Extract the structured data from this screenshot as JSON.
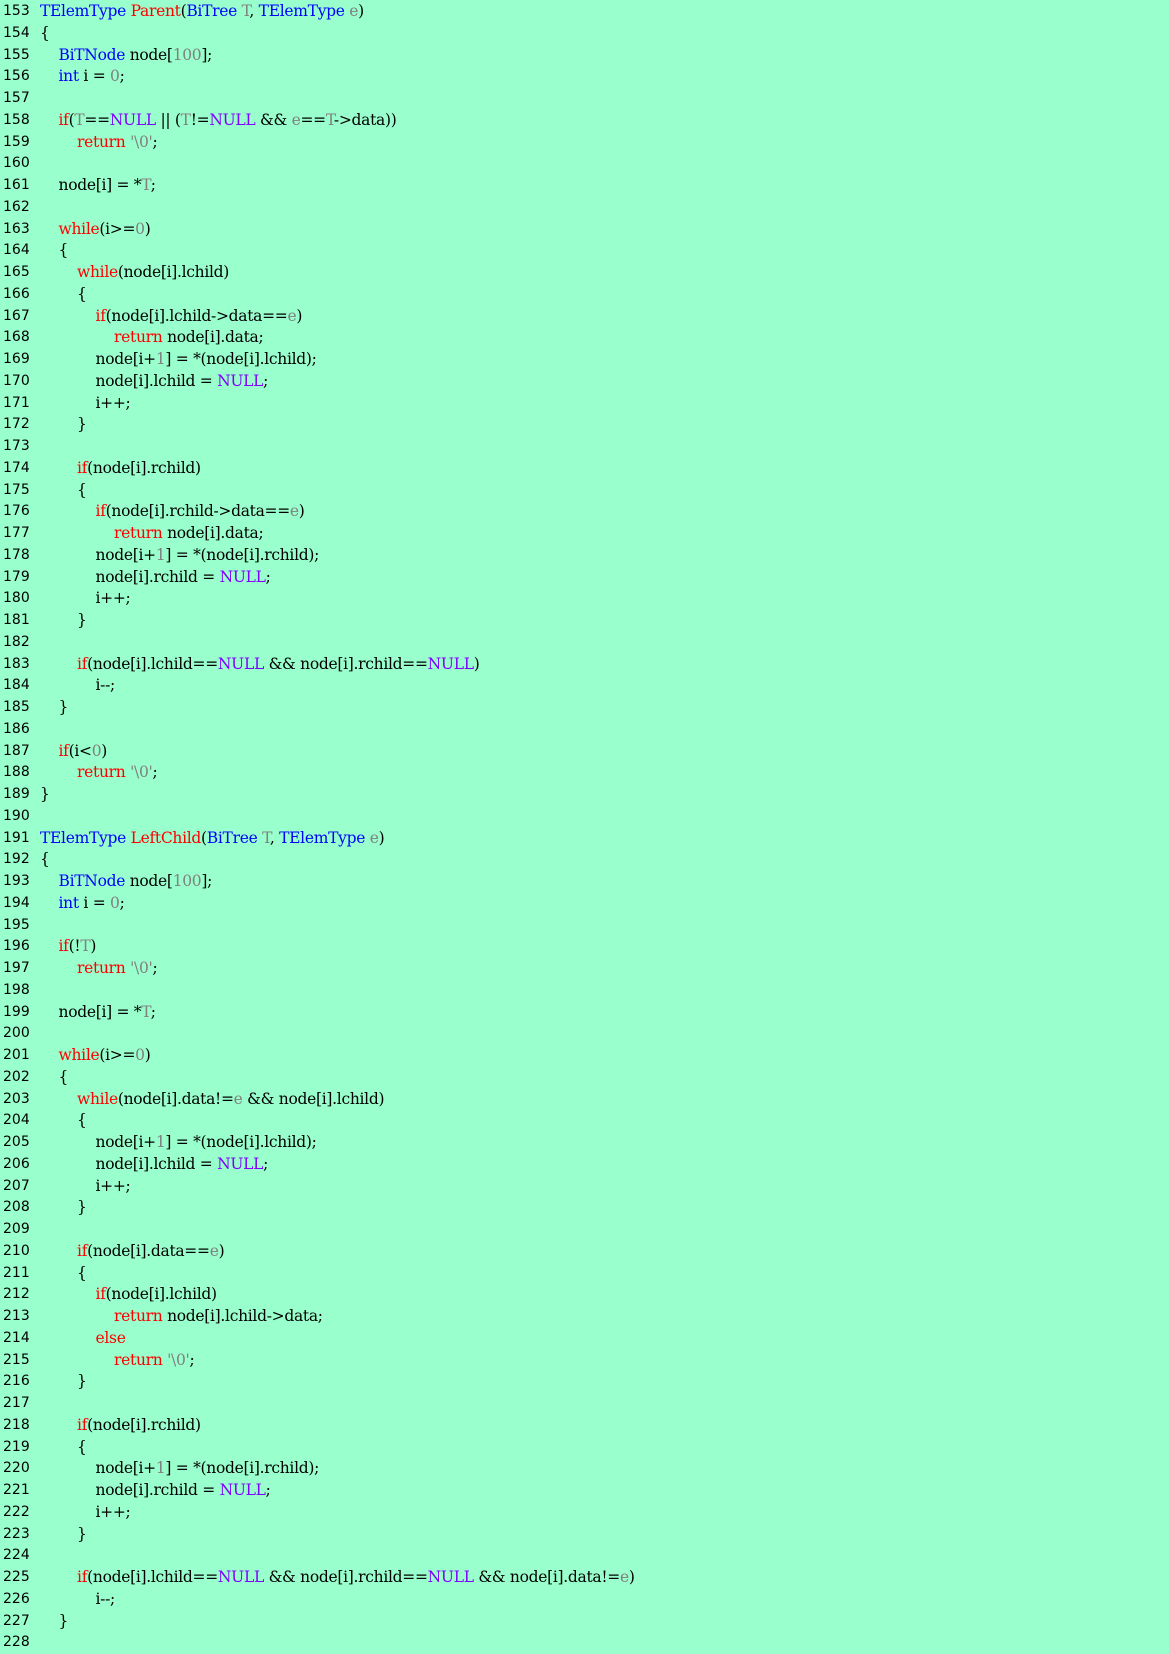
{
  "editor": {
    "background": "#99ffcc",
    "colors": {
      "type": "#0000ff",
      "keyword": "#ff0000",
      "number": "#808080",
      "param": "#808080",
      "string": "#808080",
      "constant": "#8000ff",
      "plain": "#000000"
    },
    "lines": [
      {
        "n": "153",
        "tokens": [
          [
            "type",
            "TElemType"
          ],
          [
            "plain",
            " "
          ],
          [
            "kw",
            "Parent"
          ],
          [
            "plain",
            "("
          ],
          [
            "type",
            "BiTree"
          ],
          [
            "plain",
            " "
          ],
          [
            "param",
            "T"
          ],
          [
            "plain",
            ", "
          ],
          [
            "type",
            "TElemType"
          ],
          [
            "plain",
            " "
          ],
          [
            "param",
            "e"
          ],
          [
            "plain",
            ")"
          ]
        ]
      },
      {
        "n": "154",
        "tokens": [
          [
            "plain",
            "{"
          ]
        ]
      },
      {
        "n": "155",
        "tokens": [
          [
            "plain",
            "    "
          ],
          [
            "type",
            "BiTNode"
          ],
          [
            "plain",
            " node["
          ],
          [
            "num",
            "100"
          ],
          [
            "plain",
            "];"
          ]
        ]
      },
      {
        "n": "156",
        "tokens": [
          [
            "plain",
            "    "
          ],
          [
            "type",
            "int"
          ],
          [
            "plain",
            " i = "
          ],
          [
            "num",
            "0"
          ],
          [
            "plain",
            ";"
          ]
        ]
      },
      {
        "n": "157",
        "tokens": []
      },
      {
        "n": "158",
        "tokens": [
          [
            "plain",
            "    "
          ],
          [
            "kw",
            "if"
          ],
          [
            "plain",
            "("
          ],
          [
            "param",
            "T"
          ],
          [
            "plain",
            "=="
          ],
          [
            "const",
            "NULL"
          ],
          [
            "plain",
            " || ("
          ],
          [
            "param",
            "T"
          ],
          [
            "plain",
            "!="
          ],
          [
            "const",
            "NULL"
          ],
          [
            "plain",
            " && "
          ],
          [
            "param",
            "e"
          ],
          [
            "plain",
            "=="
          ],
          [
            "param",
            "T"
          ],
          [
            "plain",
            "->data))"
          ]
        ]
      },
      {
        "n": "159",
        "tokens": [
          [
            "plain",
            "        "
          ],
          [
            "kw",
            "return"
          ],
          [
            "plain",
            " "
          ],
          [
            "str",
            "'\\0'"
          ],
          [
            "plain",
            ";"
          ]
        ]
      },
      {
        "n": "160",
        "tokens": []
      },
      {
        "n": "161",
        "tokens": [
          [
            "plain",
            "    node[i] = *"
          ],
          [
            "param",
            "T"
          ],
          [
            "plain",
            ";"
          ]
        ]
      },
      {
        "n": "162",
        "tokens": []
      },
      {
        "n": "163",
        "tokens": [
          [
            "plain",
            "    "
          ],
          [
            "kw",
            "while"
          ],
          [
            "plain",
            "(i>="
          ],
          [
            "num",
            "0"
          ],
          [
            "plain",
            ")"
          ]
        ]
      },
      {
        "n": "164",
        "tokens": [
          [
            "plain",
            "    {"
          ]
        ]
      },
      {
        "n": "165",
        "tokens": [
          [
            "plain",
            "        "
          ],
          [
            "kw",
            "while"
          ],
          [
            "plain",
            "(node[i].lchild)"
          ]
        ]
      },
      {
        "n": "166",
        "tokens": [
          [
            "plain",
            "        {"
          ]
        ]
      },
      {
        "n": "167",
        "tokens": [
          [
            "plain",
            "            "
          ],
          [
            "kw",
            "if"
          ],
          [
            "plain",
            "(node[i].lchild->data=="
          ],
          [
            "param",
            "e"
          ],
          [
            "plain",
            ")"
          ]
        ]
      },
      {
        "n": "168",
        "tokens": [
          [
            "plain",
            "                "
          ],
          [
            "kw",
            "return"
          ],
          [
            "plain",
            " node[i].data;"
          ]
        ]
      },
      {
        "n": "169",
        "tokens": [
          [
            "plain",
            "            node[i+"
          ],
          [
            "num",
            "1"
          ],
          [
            "plain",
            "] = *(node[i].lchild);"
          ]
        ]
      },
      {
        "n": "170",
        "tokens": [
          [
            "plain",
            "            node[i].lchild = "
          ],
          [
            "const",
            "NULL"
          ],
          [
            "plain",
            ";"
          ]
        ]
      },
      {
        "n": "171",
        "tokens": [
          [
            "plain",
            "            i++;"
          ]
        ]
      },
      {
        "n": "172",
        "tokens": [
          [
            "plain",
            "        }"
          ]
        ]
      },
      {
        "n": "173",
        "tokens": []
      },
      {
        "n": "174",
        "tokens": [
          [
            "plain",
            "        "
          ],
          [
            "kw",
            "if"
          ],
          [
            "plain",
            "(node[i].rchild)"
          ]
        ]
      },
      {
        "n": "175",
        "tokens": [
          [
            "plain",
            "        {"
          ]
        ]
      },
      {
        "n": "176",
        "tokens": [
          [
            "plain",
            "            "
          ],
          [
            "kw",
            "if"
          ],
          [
            "plain",
            "(node[i].rchild->data=="
          ],
          [
            "param",
            "e"
          ],
          [
            "plain",
            ")"
          ]
        ]
      },
      {
        "n": "177",
        "tokens": [
          [
            "plain",
            "                "
          ],
          [
            "kw",
            "return"
          ],
          [
            "plain",
            " node[i].data;"
          ]
        ]
      },
      {
        "n": "178",
        "tokens": [
          [
            "plain",
            "            node[i+"
          ],
          [
            "num",
            "1"
          ],
          [
            "plain",
            "] = *(node[i].rchild);"
          ]
        ]
      },
      {
        "n": "179",
        "tokens": [
          [
            "plain",
            "            node[i].rchild = "
          ],
          [
            "const",
            "NULL"
          ],
          [
            "plain",
            ";"
          ]
        ]
      },
      {
        "n": "180",
        "tokens": [
          [
            "plain",
            "            i++;"
          ]
        ]
      },
      {
        "n": "181",
        "tokens": [
          [
            "plain",
            "        }"
          ]
        ]
      },
      {
        "n": "182",
        "tokens": []
      },
      {
        "n": "183",
        "tokens": [
          [
            "plain",
            "        "
          ],
          [
            "kw",
            "if"
          ],
          [
            "plain",
            "(node[i].lchild=="
          ],
          [
            "const",
            "NULL"
          ],
          [
            "plain",
            " && node[i].rchild=="
          ],
          [
            "const",
            "NULL"
          ],
          [
            "plain",
            ")"
          ]
        ]
      },
      {
        "n": "184",
        "tokens": [
          [
            "plain",
            "            i--;"
          ]
        ]
      },
      {
        "n": "185",
        "tokens": [
          [
            "plain",
            "    }"
          ]
        ]
      },
      {
        "n": "186",
        "tokens": []
      },
      {
        "n": "187",
        "tokens": [
          [
            "plain",
            "    "
          ],
          [
            "kw",
            "if"
          ],
          [
            "plain",
            "(i<"
          ],
          [
            "num",
            "0"
          ],
          [
            "plain",
            ")"
          ]
        ]
      },
      {
        "n": "188",
        "tokens": [
          [
            "plain",
            "        "
          ],
          [
            "kw",
            "return"
          ],
          [
            "plain",
            " "
          ],
          [
            "str",
            "'\\0'"
          ],
          [
            "plain",
            ";"
          ]
        ]
      },
      {
        "n": "189",
        "tokens": [
          [
            "plain",
            "}"
          ]
        ]
      },
      {
        "n": "190",
        "tokens": []
      },
      {
        "n": "191",
        "tokens": [
          [
            "type",
            "TElemType"
          ],
          [
            "plain",
            " "
          ],
          [
            "kw",
            "LeftChild"
          ],
          [
            "plain",
            "("
          ],
          [
            "type",
            "BiTree"
          ],
          [
            "plain",
            " "
          ],
          [
            "param",
            "T"
          ],
          [
            "plain",
            ", "
          ],
          [
            "type",
            "TElemType"
          ],
          [
            "plain",
            " "
          ],
          [
            "param",
            "e"
          ],
          [
            "plain",
            ")"
          ]
        ]
      },
      {
        "n": "192",
        "tokens": [
          [
            "plain",
            "{"
          ]
        ]
      },
      {
        "n": "193",
        "tokens": [
          [
            "plain",
            "    "
          ],
          [
            "type",
            "BiTNode"
          ],
          [
            "plain",
            " node["
          ],
          [
            "num",
            "100"
          ],
          [
            "plain",
            "];"
          ]
        ]
      },
      {
        "n": "194",
        "tokens": [
          [
            "plain",
            "    "
          ],
          [
            "type",
            "int"
          ],
          [
            "plain",
            " i = "
          ],
          [
            "num",
            "0"
          ],
          [
            "plain",
            ";"
          ]
        ]
      },
      {
        "n": "195",
        "tokens": []
      },
      {
        "n": "196",
        "tokens": [
          [
            "plain",
            "    "
          ],
          [
            "kw",
            "if"
          ],
          [
            "plain",
            "(!"
          ],
          [
            "param",
            "T"
          ],
          [
            "plain",
            ")"
          ]
        ]
      },
      {
        "n": "197",
        "tokens": [
          [
            "plain",
            "        "
          ],
          [
            "kw",
            "return"
          ],
          [
            "plain",
            " "
          ],
          [
            "str",
            "'\\0'"
          ],
          [
            "plain",
            ";"
          ]
        ]
      },
      {
        "n": "198",
        "tokens": []
      },
      {
        "n": "199",
        "tokens": [
          [
            "plain",
            "    node[i] = *"
          ],
          [
            "param",
            "T"
          ],
          [
            "plain",
            ";"
          ]
        ]
      },
      {
        "n": "200",
        "tokens": []
      },
      {
        "n": "201",
        "tokens": [
          [
            "plain",
            "    "
          ],
          [
            "kw",
            "while"
          ],
          [
            "plain",
            "(i>="
          ],
          [
            "num",
            "0"
          ],
          [
            "plain",
            ")"
          ]
        ]
      },
      {
        "n": "202",
        "tokens": [
          [
            "plain",
            "    {"
          ]
        ]
      },
      {
        "n": "203",
        "tokens": [
          [
            "plain",
            "        "
          ],
          [
            "kw",
            "while"
          ],
          [
            "plain",
            "(node[i].data!="
          ],
          [
            "param",
            "e"
          ],
          [
            "plain",
            " && node[i].lchild)"
          ]
        ]
      },
      {
        "n": "204",
        "tokens": [
          [
            "plain",
            "        {"
          ]
        ]
      },
      {
        "n": "205",
        "tokens": [
          [
            "plain",
            "            node[i+"
          ],
          [
            "num",
            "1"
          ],
          [
            "plain",
            "] = *(node[i].lchild);"
          ]
        ]
      },
      {
        "n": "206",
        "tokens": [
          [
            "plain",
            "            node[i].lchild = "
          ],
          [
            "const",
            "NULL"
          ],
          [
            "plain",
            ";"
          ]
        ]
      },
      {
        "n": "207",
        "tokens": [
          [
            "plain",
            "            i++;"
          ]
        ]
      },
      {
        "n": "208",
        "tokens": [
          [
            "plain",
            "        }"
          ]
        ]
      },
      {
        "n": "209",
        "tokens": []
      },
      {
        "n": "210",
        "tokens": [
          [
            "plain",
            "        "
          ],
          [
            "kw",
            "if"
          ],
          [
            "plain",
            "(node[i].data=="
          ],
          [
            "param",
            "e"
          ],
          [
            "plain",
            ")"
          ]
        ]
      },
      {
        "n": "211",
        "tokens": [
          [
            "plain",
            "        {"
          ]
        ]
      },
      {
        "n": "212",
        "tokens": [
          [
            "plain",
            "            "
          ],
          [
            "kw",
            "if"
          ],
          [
            "plain",
            "(node[i].lchild)"
          ]
        ]
      },
      {
        "n": "213",
        "tokens": [
          [
            "plain",
            "                "
          ],
          [
            "kw",
            "return"
          ],
          [
            "plain",
            " node[i].lchild->data;"
          ]
        ]
      },
      {
        "n": "214",
        "tokens": [
          [
            "plain",
            "            "
          ],
          [
            "kw",
            "else"
          ]
        ]
      },
      {
        "n": "215",
        "tokens": [
          [
            "plain",
            "                "
          ],
          [
            "kw",
            "return"
          ],
          [
            "plain",
            " "
          ],
          [
            "str",
            "'\\0'"
          ],
          [
            "plain",
            ";"
          ]
        ]
      },
      {
        "n": "216",
        "tokens": [
          [
            "plain",
            "        }"
          ]
        ]
      },
      {
        "n": "217",
        "tokens": []
      },
      {
        "n": "218",
        "tokens": [
          [
            "plain",
            "        "
          ],
          [
            "kw",
            "if"
          ],
          [
            "plain",
            "(node[i].rchild)"
          ]
        ]
      },
      {
        "n": "219",
        "tokens": [
          [
            "plain",
            "        {"
          ]
        ]
      },
      {
        "n": "220",
        "tokens": [
          [
            "plain",
            "            node[i+"
          ],
          [
            "num",
            "1"
          ],
          [
            "plain",
            "] = *(node[i].rchild);"
          ]
        ]
      },
      {
        "n": "221",
        "tokens": [
          [
            "plain",
            "            node[i].rchild = "
          ],
          [
            "const",
            "NULL"
          ],
          [
            "plain",
            ";"
          ]
        ]
      },
      {
        "n": "222",
        "tokens": [
          [
            "plain",
            "            i++;"
          ]
        ]
      },
      {
        "n": "223",
        "tokens": [
          [
            "plain",
            "        }"
          ]
        ]
      },
      {
        "n": "224",
        "tokens": []
      },
      {
        "n": "225",
        "tokens": [
          [
            "plain",
            "        "
          ],
          [
            "kw",
            "if"
          ],
          [
            "plain",
            "(node[i].lchild=="
          ],
          [
            "const",
            "NULL"
          ],
          [
            "plain",
            " && node[i].rchild=="
          ],
          [
            "const",
            "NULL"
          ],
          [
            "plain",
            " && node[i].data!="
          ],
          [
            "param",
            "e"
          ],
          [
            "plain",
            ")"
          ]
        ]
      },
      {
        "n": "226",
        "tokens": [
          [
            "plain",
            "            i--;"
          ]
        ]
      },
      {
        "n": "227",
        "tokens": [
          [
            "plain",
            "    }"
          ]
        ]
      },
      {
        "n": "228",
        "tokens": []
      }
    ]
  }
}
